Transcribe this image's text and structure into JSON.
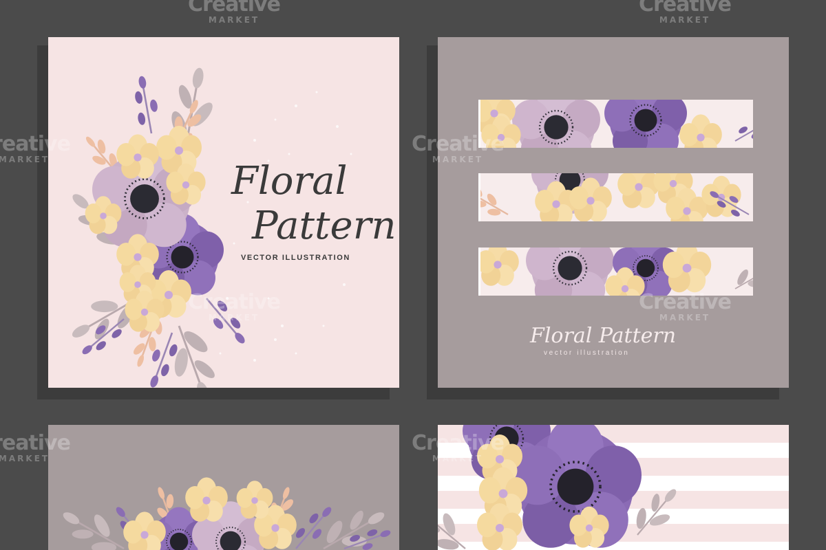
{
  "watermark": {
    "line1": "Creative",
    "line2": "MARKET"
  },
  "card1": {
    "title_line1": "Floral",
    "title_line2": "Pattern",
    "subtitle": "VECTOR ILLUSTRATION"
  },
  "card2": {
    "title": "Floral Pattern",
    "subtitle": "vector illustration"
  },
  "colors": {
    "background": "#4b4b4b",
    "card_pink": "#f6e4e4",
    "card_mauve": "#a69c9d",
    "purple": "#8b6bb5",
    "lilac": "#cbb2c9",
    "cream": "#f6dca6",
    "dark_text": "#3a3a3a"
  }
}
